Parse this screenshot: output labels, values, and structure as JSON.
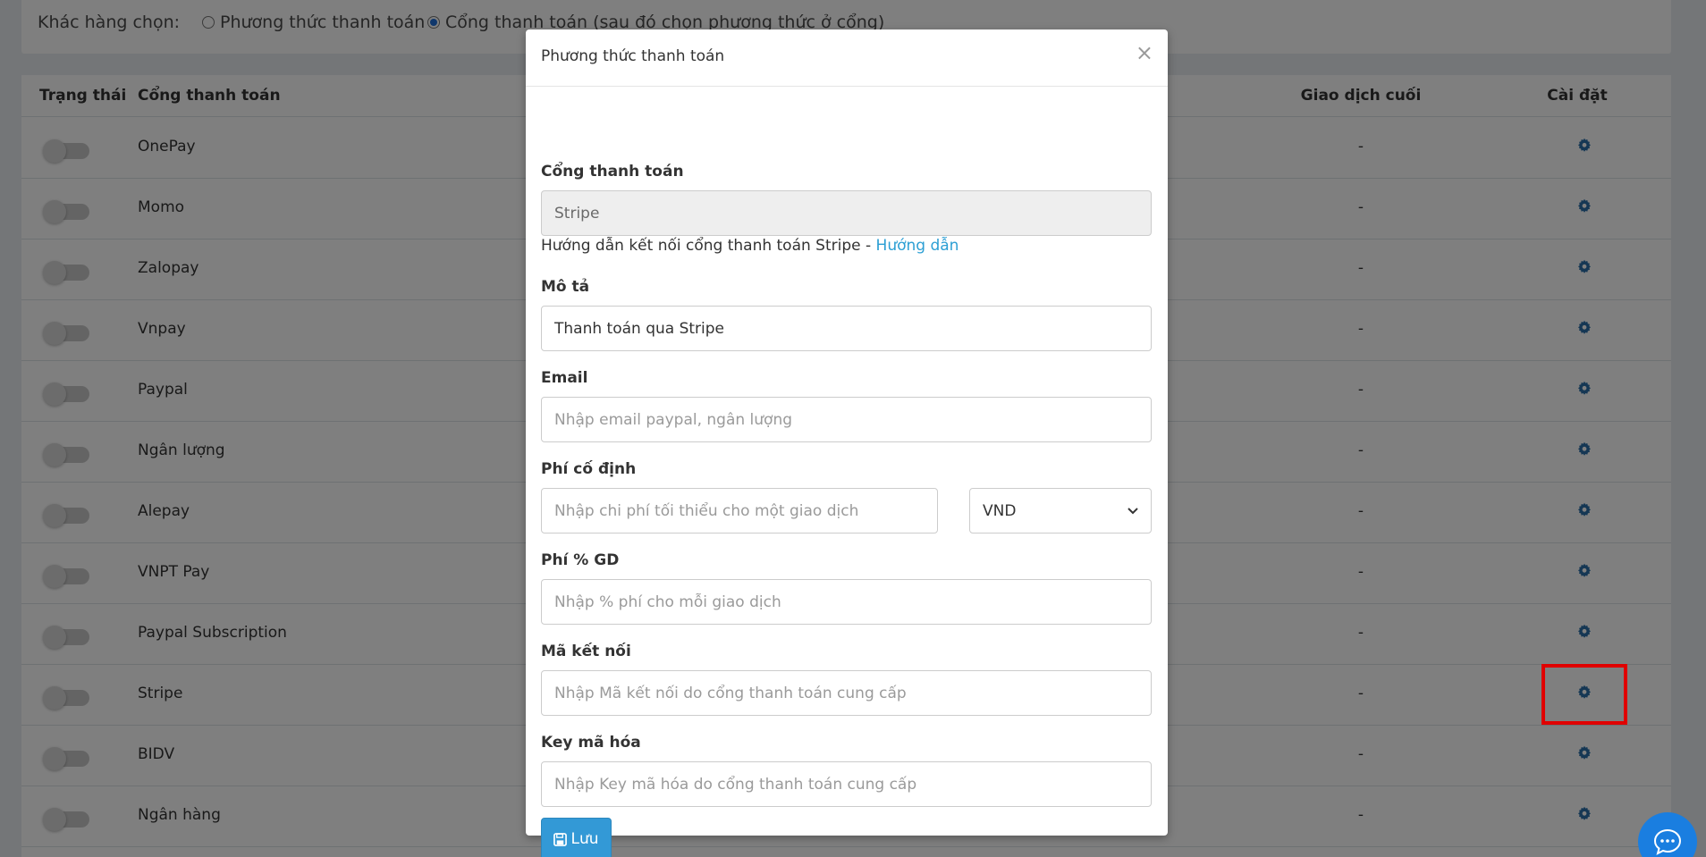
{
  "choice_bar": {
    "label": "Khác hàng chọn:",
    "option_1": "Phương thức thanh toán",
    "option_2": "Cổng thanh toán (sau đó chọn phương thức ở cổng)"
  },
  "table": {
    "headers": {
      "status": "Trạng thái",
      "gateway": "Cổng thanh toán",
      "last_transaction": "Giao dịch cuối",
      "settings": "Cài đặt"
    },
    "rows": [
      {
        "name": "OnePay",
        "last": "-"
      },
      {
        "name": "Momo",
        "last": "-"
      },
      {
        "name": "Zalopay",
        "last": "-"
      },
      {
        "name": "Vnpay",
        "last": "-"
      },
      {
        "name": "Paypal",
        "last": "-"
      },
      {
        "name": "Ngân lượng",
        "last": "-"
      },
      {
        "name": "Alepay",
        "last": "-"
      },
      {
        "name": "VNPT Pay",
        "last": "-"
      },
      {
        "name": "Paypal Subscription",
        "last": "-"
      },
      {
        "name": "Stripe",
        "last": "-"
      },
      {
        "name": "BIDV",
        "last": "-"
      },
      {
        "name": "Ngân hàng",
        "last": "-"
      }
    ]
  },
  "modal": {
    "title": "Phương thức thanh toán",
    "close": "×",
    "gateway_label": "Cổng thanh toán",
    "gateway_value": "Stripe",
    "guide_text": "Hướng dẫn kết nối cổng thanh toán Stripe - ",
    "guide_link": "Hướng dẫn",
    "description_label": "Mô tả",
    "description_value": "Thanh toán qua Stripe",
    "email_label": "Email",
    "email_placeholder": "Nhập email paypal, ngân lượng",
    "fixed_fee_label": "Phí cố định",
    "fixed_fee_placeholder": "Nhập chi phí tối thiểu cho một giao dịch",
    "currency_value": "VND",
    "percent_fee_label": "Phí % GD",
    "percent_fee_placeholder": "Nhập % phí cho mỗi giao dịch",
    "connection_code_label": "Mã kết nối",
    "connection_code_placeholder": "Nhập Mã kết nối do cổng thanh toán cung cấp",
    "encryption_key_label": "Key mã hóa",
    "encryption_key_placeholder": "Nhập Key mã hóa do cổng thanh toán cung cấp",
    "save_label": "Lưu"
  },
  "colors": {
    "accent": "#3399d6",
    "link": "#2c9fd4",
    "highlight": "#e00000",
    "chat": "#1a7ee0"
  }
}
